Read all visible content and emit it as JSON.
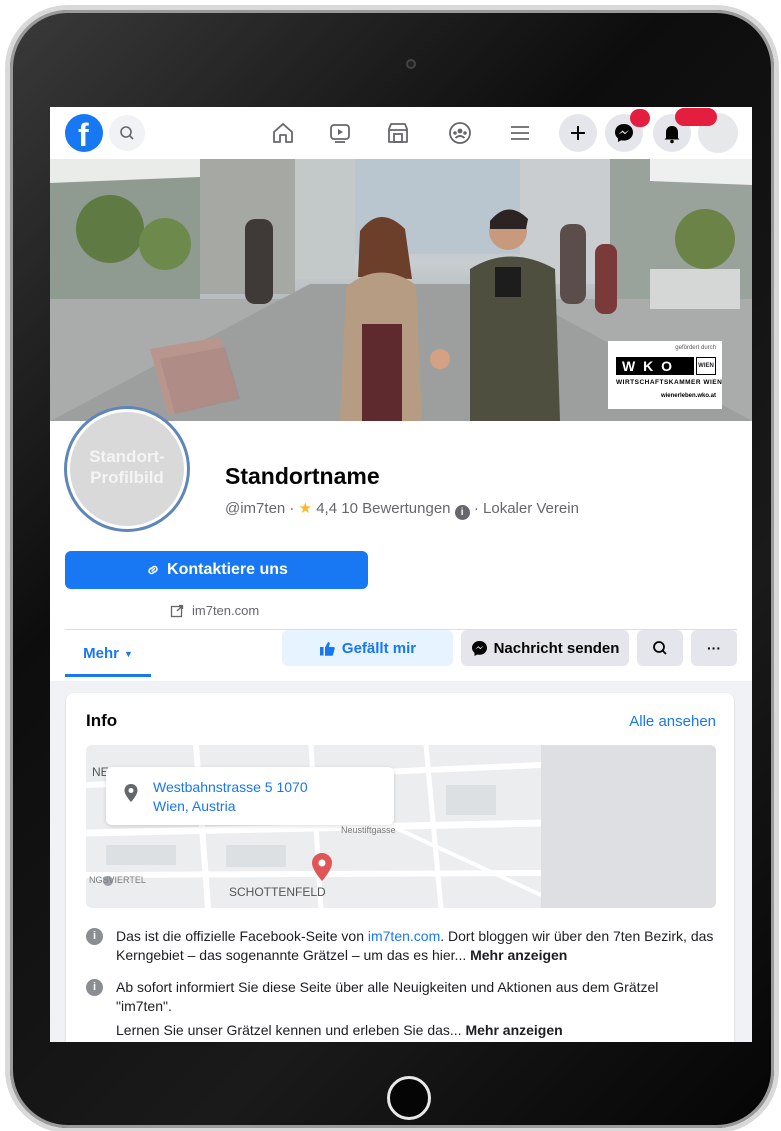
{
  "nav": {
    "logo": "f"
  },
  "cover": {
    "sponsor_note": "gefördert durch",
    "sponsor_logo_letters": "W K O",
    "sponsor_logo_city": "WIEN",
    "sponsor_name": "WIRTSCHAFTSKAMMER WIEN",
    "sponsor_url": "wienerleben.wko.at"
  },
  "profile": {
    "avatar_placeholder": "Standort-\nProfilbild",
    "name": "Standortname",
    "handle": "@im7ten",
    "rating": "4,4",
    "reviews": "10 Bewertungen",
    "category": "Lokaler Verein",
    "contact_button": "Kontaktiere uns",
    "website": "im7ten.com"
  },
  "tabs": {
    "more": "Mehr",
    "like": "Gefällt mir",
    "message": "Nachricht senden",
    "dots": "···"
  },
  "info": {
    "title": "Info",
    "see_all": "Alle ansehen",
    "address_line1": "Westbahnstrasse 5 1070",
    "address_line2": "Wien, Austria",
    "map_labels": [
      "NE",
      "Neustiftgasse",
      "NGSVIERTEL",
      "SCHOTTENFELD"
    ],
    "p1_before": "Das ist die offizielle Facebook-Seite von ",
    "p1_link": "im7ten.com",
    "p1_after": ". Dort bloggen wir über den 7ten Bezirk, das Kerngebiet – das sogenannte Grätzel – um das es hier...",
    "p1_more": "Mehr anzeigen",
    "p2": "Ab sofort informiert Sie diese Seite über alle Neuigkeiten und Aktionen aus dem Grätzel \"im7ten\".",
    "p3": "Lernen Sie unser Grätzel kennen und erleben Sie das...",
    "p3_more": "Mehr anzeigen"
  },
  "colors": {
    "facebook_blue": "#1877f2",
    "notification_red": "#e41e3f",
    "page_bg": "#f0f2f5"
  }
}
